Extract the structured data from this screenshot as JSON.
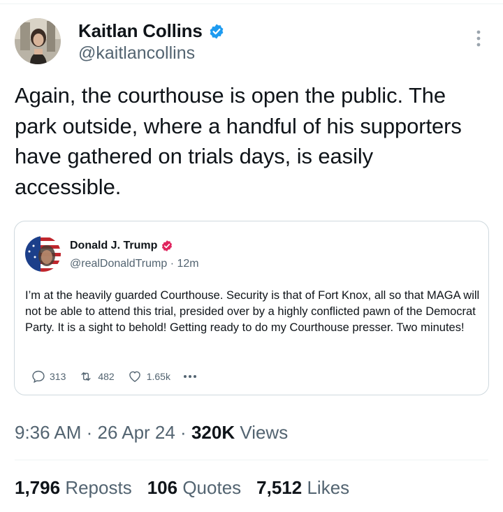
{
  "tweet": {
    "author": {
      "name": "Kaitlan Collins",
      "handle": "@kaitlancollins",
      "verified": true,
      "verified_color": "#1d9bf0"
    },
    "text": "Again, the courthouse is open the public. The park outside, where a handful of his supporters have gathered on trials days, is easily accessible.",
    "more_icon": "more-vertical-icon",
    "quoted": {
      "author": {
        "name": "Donald J. Trump",
        "handle": "@realDonaldTrump · 12m",
        "verified": true,
        "verified_color": "#e0245e"
      },
      "text": "I’m at the heavily guarded Courthouse. Security is that of Fort Knox, all so that MAGA will not be able to attend this trial, presided over by a highly conflicted pawn of the Democrat Party. It is a sight to behold! Getting ready to do my Courthouse presser. Two minutes!",
      "actions": {
        "replies": "313",
        "reposts": "482",
        "likes": "1.65k"
      }
    },
    "meta": {
      "time": "9:36 AM",
      "sep1": " · ",
      "date": "26 Apr 24",
      "sep2": " · ",
      "views_count": "320K",
      "views_label": " Views"
    },
    "stats": {
      "reposts_count": "1,796",
      "reposts_label": "Reposts",
      "quotes_count": "106",
      "quotes_label": "Quotes",
      "likes_count": "7,512",
      "likes_label": "Likes"
    }
  }
}
